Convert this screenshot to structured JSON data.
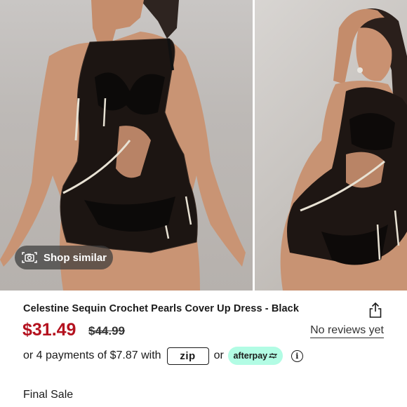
{
  "gallery": {
    "images": [
      {
        "name": "product-photo-front"
      },
      {
        "name": "product-photo-side"
      }
    ],
    "shop_similar_label": "Shop similar",
    "shop_similar_icon": "camera-icon"
  },
  "product": {
    "title": "Celestine Sequin Crochet Pearls Cover Up Dress - Black",
    "price": "$31.49",
    "original_price": "$44.99",
    "reviews_label": "No reviews yet",
    "share_icon": "share-icon",
    "sale_label": "Final Sale"
  },
  "payments": {
    "prefix": "or 4 payments of $7.87 with",
    "zip_label": "zip",
    "or_label": "or",
    "afterpay_label": "afterpay",
    "info_icon": "info-icon"
  },
  "colors": {
    "price": "#b4121f",
    "afterpay_bg": "#b2fce4",
    "text": "#1a1a1a"
  }
}
